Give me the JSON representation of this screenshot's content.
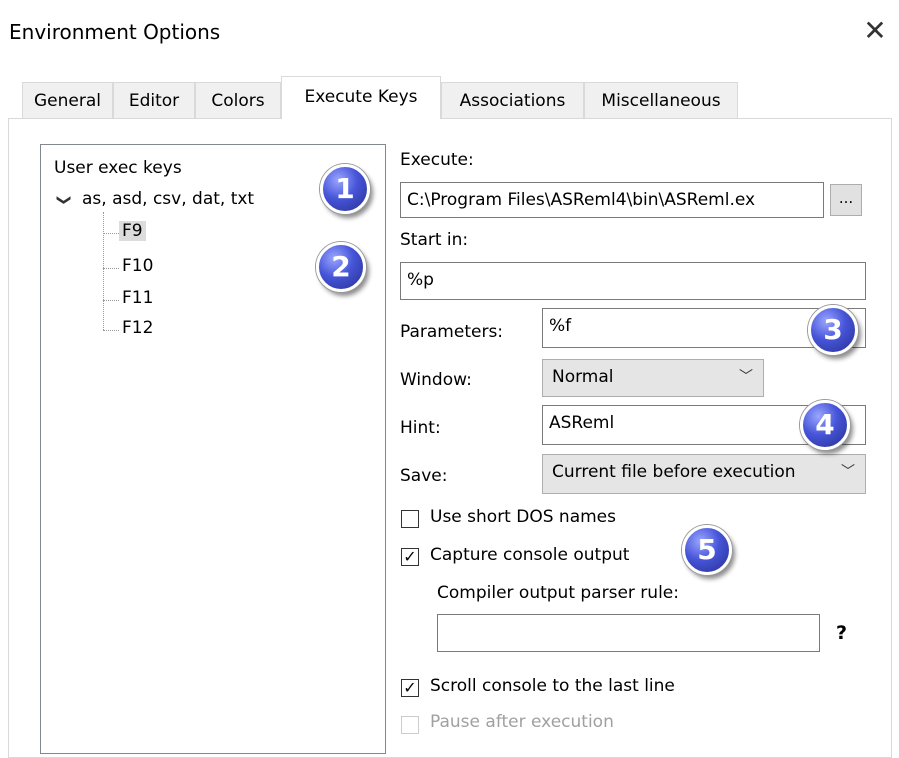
{
  "window": {
    "title": "Environment Options"
  },
  "tabs": [
    {
      "label": "General"
    },
    {
      "label": "Editor"
    },
    {
      "label": "Colors"
    },
    {
      "label": "Execute Keys"
    },
    {
      "label": "Associations"
    },
    {
      "label": "Miscellaneous"
    }
  ],
  "tree": {
    "root": "User exec keys",
    "group": "as, asd, csv, dat, txt",
    "keys": [
      "F9",
      "F10",
      "F11",
      "F12"
    ],
    "selected": "F9"
  },
  "form": {
    "execute_label": "Execute:",
    "execute_value": "C:\\Program Files\\ASReml4\\bin\\ASReml.ex",
    "browse_label": "...",
    "startin_label": "Start in:",
    "startin_value": "%p",
    "parameters_label": "Parameters:",
    "parameters_value": "%f",
    "window_label": "Window:",
    "window_value": "Normal",
    "hint_label": "Hint:",
    "hint_value": "ASReml",
    "save_label": "Save:",
    "save_value": "Current file before execution",
    "short_dos_label": "Use short DOS names",
    "short_dos_checked": false,
    "capture_label": "Capture console output",
    "capture_checked": true,
    "parser_label": "Compiler output parser rule:",
    "parser_value": "",
    "help_label": "?",
    "scroll_label": "Scroll console to the last line",
    "scroll_checked": true,
    "pause_label": "Pause after execution",
    "pause_checked": false
  },
  "badges": [
    "1",
    "2",
    "3",
    "4",
    "5"
  ]
}
